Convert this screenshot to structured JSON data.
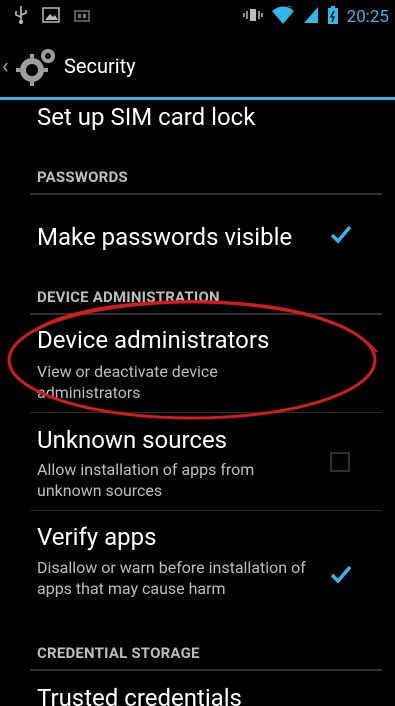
{
  "statusbar": {
    "time": "20:25"
  },
  "actionbar": {
    "title": "Security"
  },
  "list": {
    "sim_lock_title": "Set up SIM card lock",
    "passwords_header": "PASSWORDS",
    "make_passwords_title": "Make passwords visible",
    "make_passwords_checked": true,
    "device_admin_header": "DEVICE ADMINISTRATION",
    "device_admins_title": "Device administrators",
    "device_admins_summary": "View or deactivate device administrators",
    "unknown_sources_title": "Unknown sources",
    "unknown_sources_summary": "Allow installation of apps from unknown sources",
    "unknown_sources_checked": false,
    "verify_apps_title": "Verify apps",
    "verify_apps_summary": "Disallow or warn before installation of apps that may cause harm",
    "verify_apps_checked": true,
    "credential_storage_header": "CREDENTIAL STORAGE",
    "trusted_credentials_title": "Trusted credentials"
  },
  "colors": {
    "accent": "#33b5e5",
    "annotation": "#d01c1c"
  }
}
